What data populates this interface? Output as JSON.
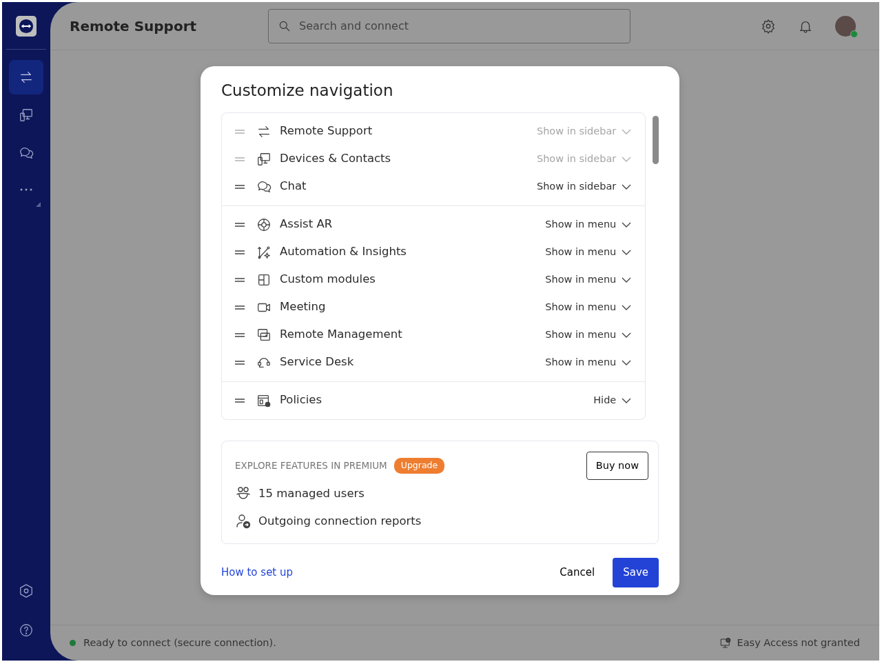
{
  "header": {
    "title": "Remote Support",
    "search": {
      "placeholder": "Search and connect"
    },
    "avatar": {
      "online": true
    }
  },
  "sidebar": {
    "items": [
      {
        "selected": true
      },
      {
        "selected": false
      },
      {
        "selected": false
      }
    ]
  },
  "dialog": {
    "title": "Customize navigation",
    "groups": [
      {
        "items": [
          {
            "label": "Remote Support",
            "option": "Show in sidebar",
            "disabled": true
          },
          {
            "label": "Devices & Contacts",
            "option": "Show in sidebar",
            "disabled": true
          },
          {
            "label": "Chat",
            "option": "Show in sidebar",
            "disabled": false
          }
        ]
      },
      {
        "items": [
          {
            "label": "Assist AR",
            "option": "Show in menu",
            "disabled": false
          },
          {
            "label": "Automation & Insights",
            "option": "Show in menu",
            "disabled": false
          },
          {
            "label": "Custom modules",
            "option": "Show in menu",
            "disabled": false
          },
          {
            "label": "Meeting",
            "option": "Show in menu",
            "disabled": false
          },
          {
            "label": "Remote Management",
            "option": "Show in menu",
            "disabled": false
          },
          {
            "label": "Service Desk",
            "option": "Show in menu",
            "disabled": false
          }
        ]
      },
      {
        "items": [
          {
            "label": "Policies",
            "option": "Hide",
            "disabled": false
          }
        ]
      }
    ],
    "premium": {
      "heading": "EXPLORE FEATURES IN PREMIUM",
      "badge": "Upgrade",
      "button": "Buy now",
      "features": [
        "15 managed users",
        "Outgoing connection reports"
      ]
    },
    "link": "How to set up",
    "cancel": "Cancel",
    "save": "Save"
  },
  "status_bar": {
    "message": "Ready to connect (secure connection).",
    "status_dot": {
      "color": "#1f7a3a"
    },
    "right": "Easy Access not granted"
  }
}
